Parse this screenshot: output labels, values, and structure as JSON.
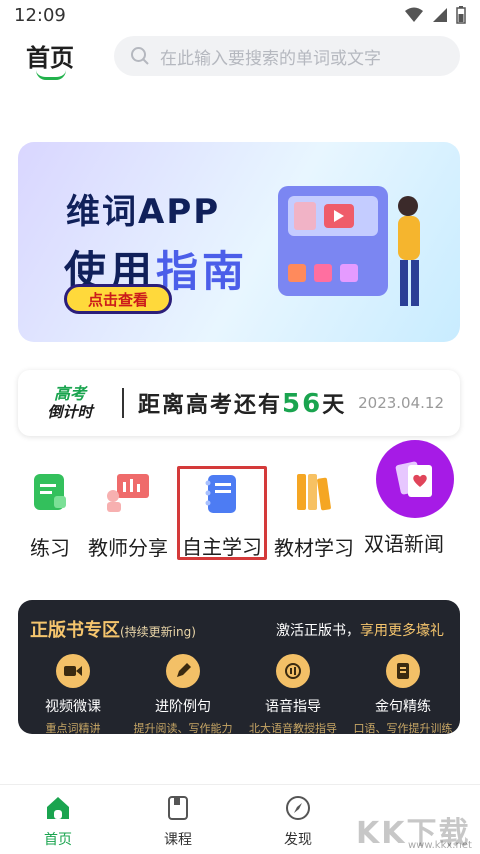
{
  "status": {
    "time": "12:09"
  },
  "header": {
    "title": "首页",
    "search_placeholder": "在此输入要搜索的单词或文字"
  },
  "banner": {
    "line1": "维词APP",
    "line2_a": "使用",
    "line2_b": "指南",
    "cta": "点击查看"
  },
  "countdown": {
    "logo_line1": "高考",
    "logo_line2": "倒计时",
    "text_prefix": "距离高考还有",
    "days": "56",
    "text_suffix": "天",
    "date": "2023.04.12"
  },
  "menu": {
    "items": [
      {
        "label": "练习",
        "icon": "practice-icon",
        "color": "#33c05c"
      },
      {
        "label": "教师分享",
        "icon": "teacher-share-icon",
        "color": "#ef6b6b"
      },
      {
        "label": "自主学习",
        "icon": "self-study-icon",
        "color": "#4d7cf3"
      },
      {
        "label": "教材学习",
        "icon": "textbook-icon",
        "color": "#f5a623"
      },
      {
        "label": "双语新闻",
        "icon": "news-card-icon",
        "color": "#a61be6"
      }
    ]
  },
  "zone": {
    "title": "正版书专区",
    "subtitle": "(持续更新ing)",
    "right_a": "激活正版书，",
    "right_b": "享用更多壕礼",
    "features": [
      {
        "title": "视频微课",
        "sub": "重点词精讲",
        "icon": "video-icon"
      },
      {
        "title": "进阶例句",
        "sub": "提升阅读、写作能力",
        "icon": "pencil-icon"
      },
      {
        "title": "语音指导",
        "sub": "北大语音教授指导",
        "icon": "voice-icon"
      },
      {
        "title": "金句精练",
        "sub": "口语、写作提升训练",
        "icon": "quote-icon"
      }
    ]
  },
  "tabs": [
    {
      "label": "首页",
      "icon": "home-icon"
    },
    {
      "label": "课程",
      "icon": "course-icon"
    },
    {
      "label": "发现",
      "icon": "compass-icon"
    }
  ],
  "watermark": {
    "text": "KK下载",
    "url": "www.kkx.net"
  }
}
